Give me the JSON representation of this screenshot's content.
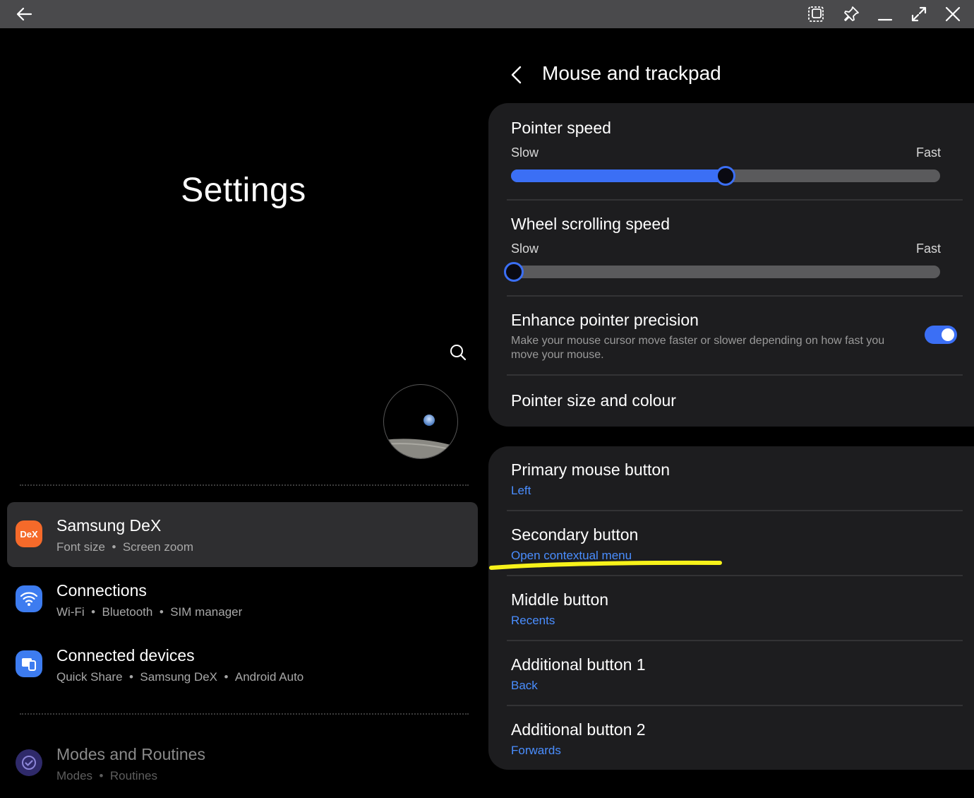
{
  "left": {
    "title": "Settings",
    "nav": [
      {
        "title": "Samsung DeX",
        "sub": [
          "Font size",
          "Screen zoom"
        ],
        "icon": "dex-icon",
        "icon_text": "DeX",
        "color": "#f56a2a",
        "active": true
      },
      {
        "title": "Connections",
        "sub": [
          "Wi-Fi",
          "Bluetooth",
          "SIM manager"
        ],
        "icon": "wifi-icon",
        "color": "#3d7cf0"
      },
      {
        "title": "Connected devices",
        "sub": [
          "Quick Share",
          "Samsung DeX",
          "Android Auto"
        ],
        "icon": "devices-icon",
        "color": "#3d7cf0"
      },
      {
        "title": "Modes and Routines",
        "sub": [
          "Modes",
          "Routines"
        ],
        "icon": "check-circle-icon",
        "color": "#3a3480"
      }
    ],
    "separator": "•"
  },
  "right": {
    "header_title": "Mouse and trackpad",
    "pointer_speed": {
      "title": "Pointer speed",
      "min_label": "Slow",
      "max_label": "Fast",
      "value": 0.5
    },
    "wheel_speed": {
      "title": "Wheel scrolling speed",
      "min_label": "Slow",
      "max_label": "Fast",
      "value": 0.0
    },
    "enhance": {
      "title": "Enhance pointer precision",
      "desc": "Make your mouse cursor move faster or slower depending on how fast you move your mouse.",
      "enabled": true
    },
    "pointer_size": {
      "title": "Pointer size and colour"
    },
    "buttons": [
      {
        "title": "Primary mouse button",
        "value": "Left"
      },
      {
        "title": "Secondary button",
        "value": "Open contextual menu"
      },
      {
        "title": "Middle button",
        "value": "Recents"
      },
      {
        "title": "Additional button 1",
        "value": "Back"
      },
      {
        "title": "Additional button 2",
        "value": "Forwards"
      }
    ]
  },
  "colors": {
    "accent": "#3b6ff5",
    "link": "#4a8eff",
    "highlight": "#f7f21a"
  }
}
